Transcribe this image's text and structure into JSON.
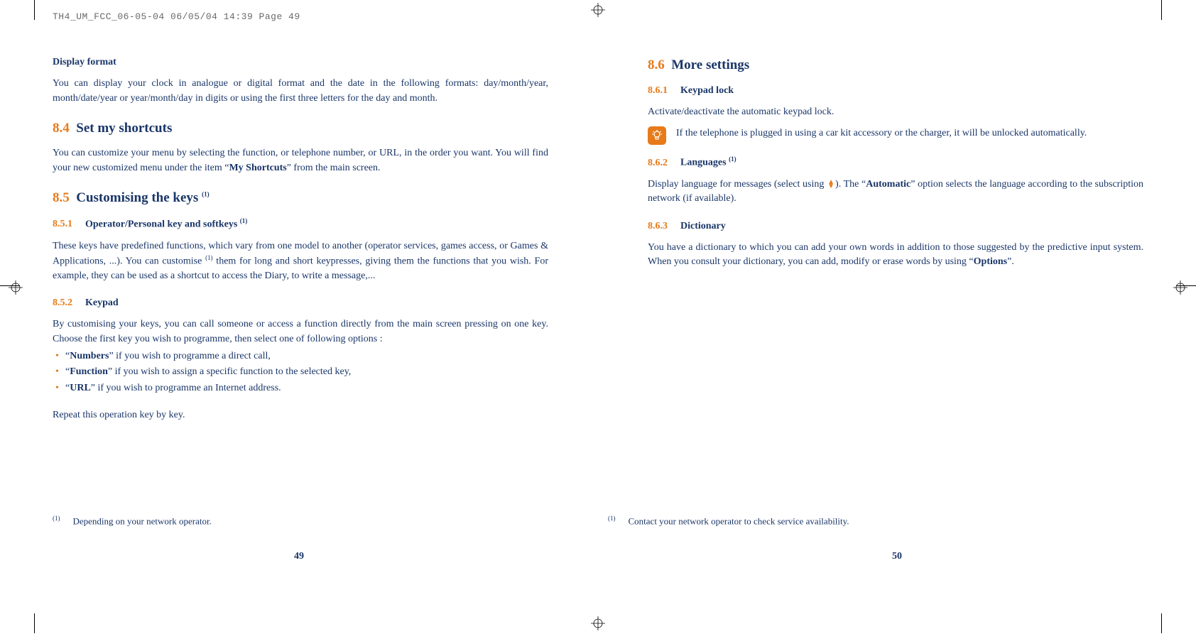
{
  "header": "TH4_UM_FCC_06-05-04  06/05/04  14:39  Page 49",
  "left": {
    "display_format_head": "Display format",
    "display_format_body": "You can display your clock in analogue or digital format and the date in the following formats: day/month/year, month/date/year or year/month/day in digits or using the first three letters for the day and month.",
    "s84_num": "8.4",
    "s84_title": "Set my shortcuts",
    "s84_body_a": "You can customize your menu by selecting the function, or telephone number, or URL, in the order you want. You will find your new customized menu under the item “",
    "s84_body_bold": "My Shortcuts",
    "s84_body_b": "” from the main screen.",
    "s85_num": "8.5",
    "s85_title": "Customising the keys ",
    "s85_sup": "(1)",
    "s851_num": "8.5.1",
    "s851_title": "Operator/Personal key and softkeys ",
    "s851_sup": "(1)",
    "s851_body_a": "These keys have predefined functions, which vary from one model to another (operator services, games access, or Games & Applications, ...). You can customise ",
    "s851_body_sup": "(1)",
    "s851_body_b": " them for long and short keypresses, giving them the functions that you wish. For example, they can be used as a shortcut to access the Diary, to write a message,...",
    "s852_num": "8.5.2",
    "s852_title": "Keypad",
    "s852_body": "By customising your keys, you can call someone or access a function directly from the main screen pressing on one key. Choose the first key you wish to programme, then select one of following options :",
    "li1_a": "“",
    "li1_bold": "Numbers",
    "li1_b": "” if you wish to programme a direct call,",
    "li2_a": "“",
    "li2_bold": "Function",
    "li2_b": "” if you wish to assign a specific function to the selected key,",
    "li3_a": "“",
    "li3_bold": "URL",
    "li3_b": "” if you wish to programme an Internet address.",
    "repeat": "Repeat this operation key by key.",
    "footnote_sup": "(1)",
    "footnote": "Depending on your network operator.",
    "pagenum": "49"
  },
  "right": {
    "s86_num": "8.6",
    "s86_title": "More settings",
    "s861_num": "8.6.1",
    "s861_title": "Keypad lock",
    "s861_body": "Activate/deactivate the automatic keypad lock.",
    "note": "If the telephone is plugged in using a car kit accessory or the charger, it will be unlocked automatically.",
    "s862_num": "8.6.2",
    "s862_title": "Languages ",
    "s862_sup": "(1)",
    "s862_body_a": "Display language for messages (select using ",
    "s862_body_b": "). The “",
    "s862_body_bold": "Automatic",
    "s862_body_c": "” option selects the language according to the subscription network (if available).",
    "s863_num": "8.6.3",
    "s863_title": "Dictionary",
    "s863_body_a": "You have a dictionary to which you can add your own words in addition to those suggested by the predictive input system. When you consult your dictionary, you can add, modify or erase words by using “",
    "s863_body_bold": "Options",
    "s863_body_b": "”.",
    "footnote_sup": "(1)",
    "footnote": "Contact your network operator to check service availability.",
    "pagenum": "50"
  }
}
